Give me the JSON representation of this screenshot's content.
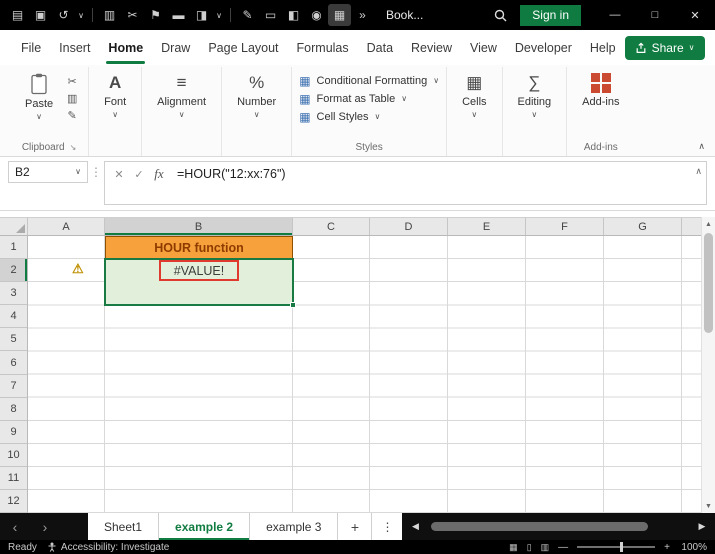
{
  "glyphs": {
    "chevron_down": "∨",
    "chevron_up": "∧",
    "dots_vertical": "⋮",
    "cancel": "✕",
    "check": "✓",
    "fx": "fx",
    "minimize": "—",
    "maximize": "□",
    "close": "✕",
    "nav_left": "‹",
    "nav_right": "›",
    "scroll_up": "▲",
    "scroll_down": "▼",
    "scroll_left": "◀",
    "scroll_right": "▶",
    "plus": "+",
    "launcher": "↘",
    "minus": "—",
    "view_normal": "▦",
    "view_layout": "▯",
    "view_break": "▥"
  },
  "colors": {
    "accent_green": "#107C41",
    "selection_green": "#1A7A44",
    "cell_fill_orange": "#F6A13B",
    "cell_text_orange": "#8F3B00",
    "cell_fill_green": "#E2EFDA",
    "error_border_red": "#E03A2F",
    "addins_icon_red": "#CB4B32"
  },
  "titlebar": {
    "workbook_title": "Book...",
    "signin_label": "Sign in",
    "icons": [
      {
        "name": "app-menu-icon",
        "glyph": "▤"
      },
      {
        "name": "save-icon",
        "glyph": "▣"
      },
      {
        "name": "undo-icon",
        "glyph": "↺"
      },
      {
        "name": "undo-dropdown-icon",
        "glyph": "∨"
      },
      {
        "name": "clipboard-icon",
        "glyph": "▥"
      },
      {
        "name": "cut-icon",
        "glyph": "✂"
      },
      {
        "name": "flag-icon",
        "glyph": "⚑"
      },
      {
        "name": "highlighter-icon",
        "glyph": "▬"
      },
      {
        "name": "shape-icon",
        "glyph": "◨"
      },
      {
        "name": "dropdown-icon",
        "glyph": "∨"
      },
      {
        "name": "draw-icon",
        "glyph": "✎"
      },
      {
        "name": "page-icon",
        "glyph": "▭"
      },
      {
        "name": "stamp-icon",
        "glyph": "◧"
      },
      {
        "name": "camera-icon",
        "glyph": "◉"
      },
      {
        "name": "table-icon",
        "glyph": "▦"
      },
      {
        "name": "overflow-icon",
        "glyph": "»"
      }
    ]
  },
  "menubar": {
    "tabs": [
      "File",
      "Insert",
      "Home",
      "Draw",
      "Page Layout",
      "Formulas",
      "Data",
      "Review",
      "View",
      "Developer",
      "Help"
    ],
    "active_tab": "Home",
    "share_label": "Share"
  },
  "ribbon": {
    "paste_label": "Paste",
    "clipboard_small_icons": [
      {
        "name": "cut-icon",
        "glyph": "✂"
      },
      {
        "name": "copy-icon",
        "glyph": "▥"
      },
      {
        "name": "format-painter-icon",
        "glyph": "✎"
      }
    ],
    "font_label": "Font",
    "font_glyph": "A",
    "alignment_label": "Alignment",
    "alignment_glyph": "≡",
    "number_label": "Number",
    "number_glyph": "%",
    "styles_items": [
      "Conditional Formatting",
      "Format as Table",
      "Cell Styles"
    ],
    "styles_icon_glyph": "▦",
    "cells_label": "Cells",
    "cells_glyph": "▦",
    "editing_label": "Editing",
    "editing_glyph": "∑",
    "addins_label": "Add-ins",
    "clipboard_group_label": "Clipboard",
    "styles_group_label": "Styles",
    "addins_group_label": "Add-ins"
  },
  "formula_bar": {
    "name_box": "B2",
    "formula": "=HOUR(\"12:xx:76\")"
  },
  "grid": {
    "columns": [
      "A",
      "B",
      "C",
      "D",
      "E",
      "F",
      "G"
    ],
    "rows": [
      "1",
      "2",
      "3",
      "4",
      "5",
      "6",
      "7",
      "8",
      "9",
      "10",
      "11",
      "12"
    ],
    "selected_cell": "B2",
    "selected_column": "B",
    "selected_row": "2",
    "cells": {
      "B1": {
        "text": "HOUR function"
      },
      "B2": {
        "text": "#VALUE!"
      },
      "B3": {
        "text": ""
      }
    },
    "warning_glyph": "⚠"
  },
  "sheet_tabs": {
    "tabs": [
      {
        "label": "Sheet1"
      },
      {
        "label": "example 2"
      },
      {
        "label": "example 3"
      }
    ],
    "active": "example 2"
  },
  "status_bar": {
    "ready_label": "Ready",
    "accessibility_label": "Accessibility: Investigate",
    "zoom_label": "100%"
  }
}
